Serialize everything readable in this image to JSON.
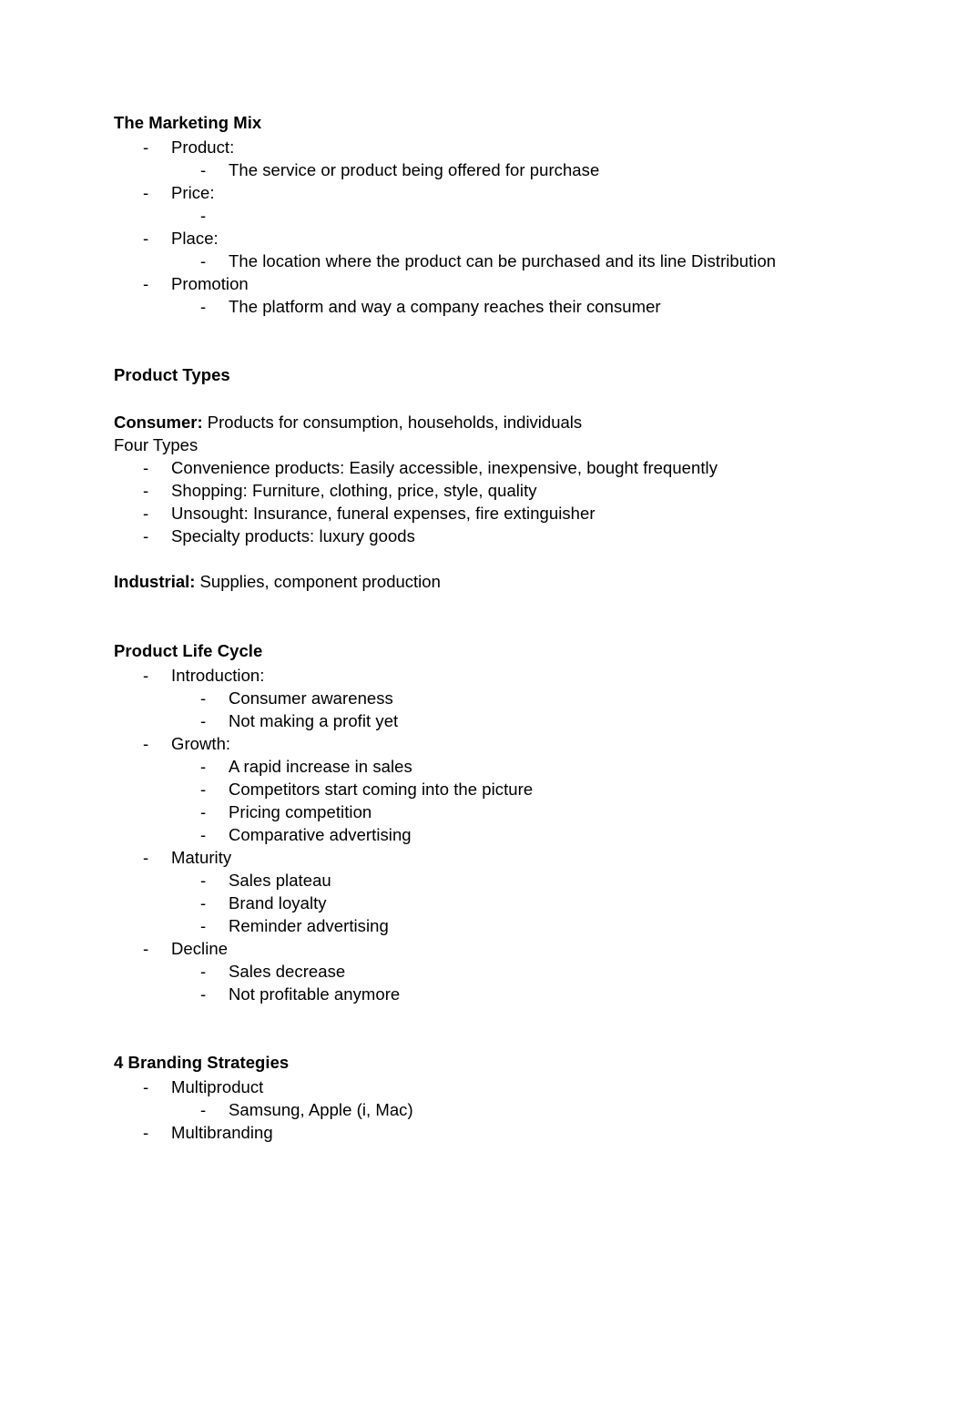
{
  "document": {
    "sections": [
      {
        "id": "marketing-mix",
        "heading": "The Marketing Mix",
        "items": [
          {
            "level": 1,
            "text": "Product:"
          },
          {
            "level": 2,
            "text": "The service or product being offered for purchase"
          },
          {
            "level": 1,
            "text": "Price:"
          },
          {
            "level": 2,
            "text": ""
          },
          {
            "level": 1,
            "text": "Place:"
          },
          {
            "level": 2,
            "text": "The location where the product can be purchased and its line Distribution"
          },
          {
            "level": 1,
            "text": "Promotion"
          },
          {
            "level": 2,
            "text": "The platform and way a company reaches their consumer"
          }
        ]
      },
      {
        "id": "product-types",
        "heading": "Product Types",
        "paragraphs": [
          {
            "lead": "Consumer:",
            "rest": " Products for consumption, households, individuals"
          },
          {
            "lead": "",
            "rest": "Four Types"
          }
        ],
        "items": [
          {
            "level": 1,
            "text": "Convenience products: Easily accessible, inexpensive, bought frequently"
          },
          {
            "level": 1,
            "text": "Shopping: Furniture, clothing, price, style, quality"
          },
          {
            "level": 1,
            "text": "Unsought: Insurance, funeral expenses, fire extinguisher"
          },
          {
            "level": 1,
            "text": "Specialty products: luxury goods"
          }
        ],
        "trailing_paragraphs": [
          {
            "lead": "Industrial:",
            "rest": " Supplies, component production"
          }
        ]
      },
      {
        "id": "product-life-cycle",
        "heading": "Product Life Cycle",
        "items": [
          {
            "level": 1,
            "text": "Introduction:"
          },
          {
            "level": 2,
            "text": "Consumer awareness"
          },
          {
            "level": 2,
            "text": "Not making a profit yet"
          },
          {
            "level": 1,
            "text": "Growth:"
          },
          {
            "level": 2,
            "text": "A rapid increase in sales"
          },
          {
            "level": 2,
            "text": "Competitors start coming into the picture"
          },
          {
            "level": 2,
            "text": "Pricing competition"
          },
          {
            "level": 2,
            "text": "Comparative advertising"
          },
          {
            "level": 1,
            "text": "Maturity"
          },
          {
            "level": 2,
            "text": "Sales plateau"
          },
          {
            "level": 2,
            "text": "Brand loyalty"
          },
          {
            "level": 2,
            "text": "Reminder advertising"
          },
          {
            "level": 1,
            "text": "Decline"
          },
          {
            "level": 2,
            "text": "Sales decrease"
          },
          {
            "level": 2,
            "text": "Not profitable anymore"
          }
        ]
      },
      {
        "id": "branding-strategies",
        "heading": "4 Branding Strategies",
        "items": [
          {
            "level": 1,
            "text": "Multiproduct"
          },
          {
            "level": 2,
            "text": "Samsung, Apple (i, Mac)"
          },
          {
            "level": 1,
            "text": "Multibranding"
          }
        ]
      }
    ],
    "bullet_glyph": "-",
    "colors": {
      "page_background": "#ffffff",
      "text": "#000000",
      "heading_highlight": "#ededed"
    }
  }
}
